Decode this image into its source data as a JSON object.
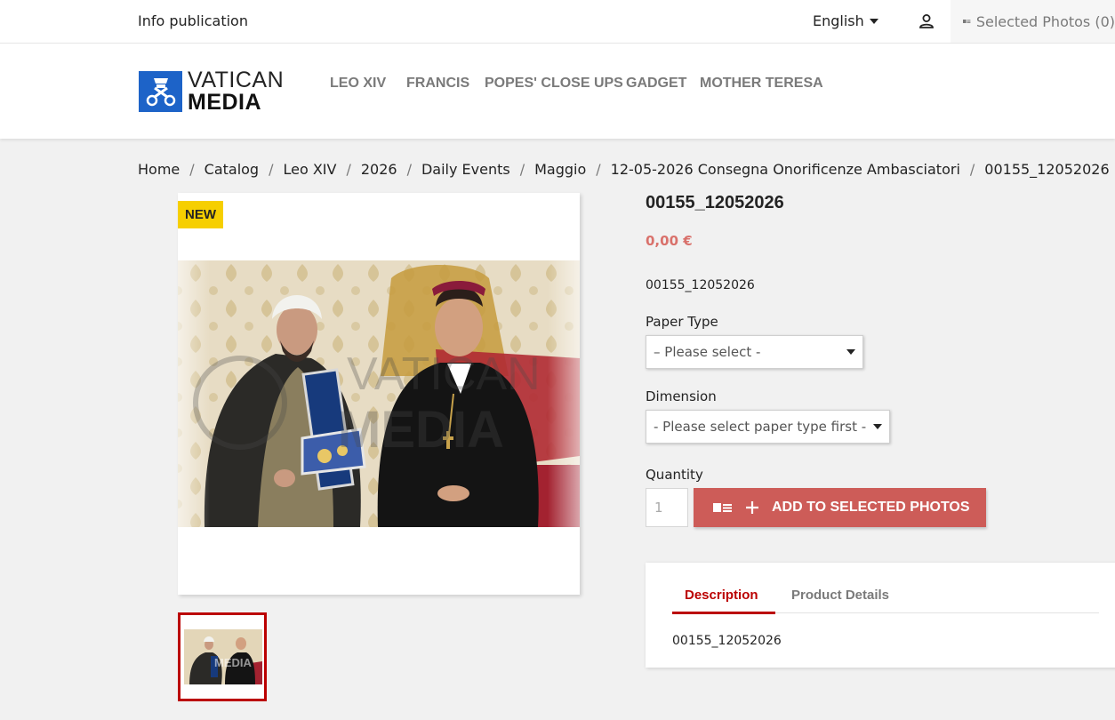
{
  "topbar": {
    "info_link": "Info publication",
    "language": "English",
    "user_icon": "user-icon",
    "selected_photos": "Selected Photos (0)"
  },
  "logo": {
    "line1": "VATICAN",
    "line2": "MEDIA"
  },
  "nav": {
    "items": [
      "LEO XIV",
      "FRANCIS",
      "POPES' CLOSE UPS",
      "GADGET",
      "MOTHER TERESA"
    ]
  },
  "breadcrumb": [
    "Home",
    "Catalog",
    "Leo XIV",
    "2026",
    "Daily Events",
    "Maggio",
    "12-05-2026 Consegna Onorificenze Ambasciatori",
    "00155_12052026"
  ],
  "product": {
    "badge": "NEW",
    "title": "00155_12052026",
    "price": "0,00 €",
    "reference": "00155_12052026",
    "paper_type_label": "Paper Type",
    "paper_type_value": "– Please select -",
    "dimension_label": "Dimension",
    "dimension_value": "- Please select paper type first -",
    "quantity_label": "Quantity",
    "quantity_value": "1",
    "add_button": "ADD TO SELECTED PHOTOS",
    "watermark_line1": "VATICAN",
    "watermark_line2": "MEDIA"
  },
  "tabs": {
    "items": [
      "Description",
      "Product Details"
    ],
    "active": "Description",
    "content": "00155_12052026"
  },
  "colors": {
    "accent": "#cd5c58",
    "active_tab": "#bb0000",
    "price": "#d9716b",
    "badge": "#f6cf00",
    "logo_blue": "#1d63c8"
  }
}
